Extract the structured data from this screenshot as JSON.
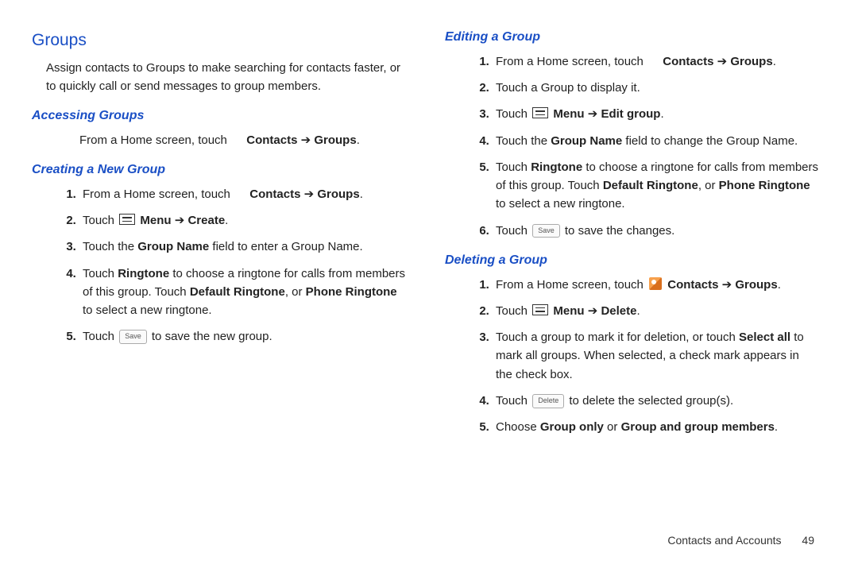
{
  "left": {
    "heading": "Groups",
    "intro": "Assign contacts to Groups to make searching for contacts faster, or to quickly call or send messages to group members.",
    "accessing": {
      "title": "Accessing Groups",
      "step_prefix": "From a Home screen, touch ",
      "contacts": "Contacts",
      "groups": "Groups"
    },
    "creating": {
      "title": "Creating a New Group",
      "s1_prefix": "From a Home screen, touch ",
      "contacts": "Contacts",
      "groups": "Groups",
      "s2_touch": "Touch ",
      "s2_menu": "Menu",
      "s2_arrow": " ➔ ",
      "s2_create": "Create",
      "s3_a": "Touch the ",
      "s3_b": "Group Name",
      "s3_c": " field to enter a Group Name.",
      "s4_a": "Touch ",
      "s4_b": "Ringtone",
      "s4_c": " to choose a ringtone for calls from members of this group. Touch ",
      "s4_d": "Default Ringtone",
      "s4_e": ", or ",
      "s4_f": "Phone Ringtone",
      "s4_g": " to select a new ringtone.",
      "s5_a": "Touch ",
      "s5_save": "Save",
      "s5_b": " to save the new group."
    }
  },
  "right": {
    "editing": {
      "title": "Editing a Group",
      "s1_prefix": "From a Home screen, touch ",
      "contacts": "Contacts",
      "groups": "Groups",
      "s2": "Touch a Group to display it.",
      "s3_touch": "Touch ",
      "s3_menu": "Menu",
      "s3_arrow": " ➔ ",
      "s3_edit": "Edit group",
      "s4_a": "Touch the ",
      "s4_b": "Group Name",
      "s4_c": " field to change the Group Name.",
      "s5_a": "Touch ",
      "s5_b": "Ringtone",
      "s5_c": " to choose a ringtone for calls from members of this group. Touch ",
      "s5_d": "Default Ringtone",
      "s5_e": ", or ",
      "s5_f": "Phone Ringtone",
      "s5_g": " to select a new ringtone.",
      "s6_a": "Touch ",
      "s6_save": "Save",
      "s6_b": " to save the changes."
    },
    "deleting": {
      "title": "Deleting a Group",
      "s1_prefix": "From a Home screen, touch ",
      "contacts": "Contacts",
      "groups": "Groups",
      "s2_touch": "Touch ",
      "s2_menu": "Menu",
      "s2_arrow": " ➔ ",
      "s2_delete": "Delete",
      "s3_a": "Touch a group to mark it for deletion, or touch ",
      "s3_b": "Select all",
      "s3_c": " to mark all groups. When selected, a check mark appears in the check box.",
      "s4_a": "Touch ",
      "s4_del": "Delete",
      "s4_b": " to delete the selected group(s).",
      "s5_a": "Choose ",
      "s5_b": "Group only",
      "s5_c": " or ",
      "s5_d": "Group and group members",
      "s5_e": "."
    }
  },
  "footer": {
    "section": "Contacts and Accounts",
    "page": "49"
  }
}
